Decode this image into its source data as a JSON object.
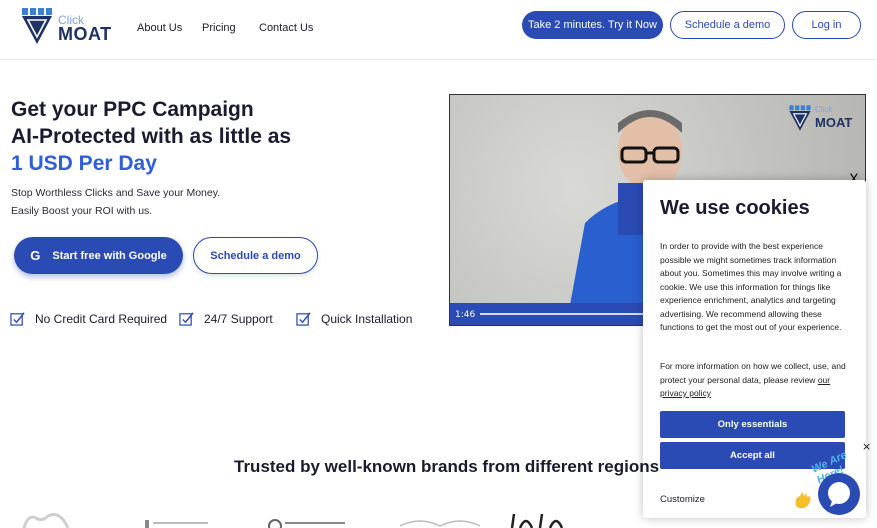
{
  "header": {
    "logo_click": "Click",
    "logo_moat": "MOAT",
    "nav": [
      "About Us",
      "Pricing",
      "Contact Us"
    ],
    "try_button": "Take 2 minutes. Try it Now",
    "demo_button": "Schedule a demo",
    "login_button": "Log in"
  },
  "hero": {
    "title_line1": "Get your PPC Campaign",
    "title_line2": "AI-Protected with as little as",
    "title_highlight": "1 USD Per Day",
    "subtitle_line1": "Stop Worthless Clicks and Save your Money.",
    "subtitle_line2": "Easily Boost your ROI with us.",
    "google_button": "Start free with Google",
    "google_icon": "G",
    "demo_button": "Schedule a demo",
    "features": [
      "No Credit Card Required",
      "24/7 Support",
      "Quick Installation"
    ]
  },
  "video": {
    "time": "1:46",
    "watermark_click": "Click",
    "watermark_moat": "MOAT"
  },
  "cookie": {
    "close": "X",
    "title": "We use cookies",
    "body1": "In order to provide with the best experience possible we might sometimes track information about you. Sometimes this may involve writing a cookie. We use this information for things like experience enrichment, analytics and targeting advertising. We recommend allowing these functions to get the most out of your experience.",
    "body2": "For more information on how we collect, use, and protect your personal data, please review",
    "privacy_link": "our privacy policy",
    "only_essentials": "Only essentials",
    "accept_all": "Accept all",
    "customize": "Customize"
  },
  "trusted": {
    "heading": "Trusted by well-known brands from different regions"
  },
  "chat": {
    "close": "×",
    "tagline": "We Are Here!"
  },
  "colors": {
    "primary": "#2a4bb4",
    "highlight": "#2f5fd7",
    "text": "#1b1b2f"
  }
}
